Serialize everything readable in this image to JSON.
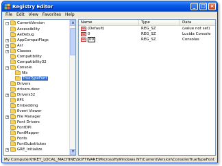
{
  "window": {
    "title": "Registry Editor",
    "icon": "registry-icon"
  },
  "titlebar_buttons": {
    "minimize": "_",
    "maximize": "□",
    "close": "×"
  },
  "menu": [
    {
      "label": "File"
    },
    {
      "label": "Edit"
    },
    {
      "label": "View"
    },
    {
      "label": "Favorites"
    },
    {
      "label": "Help"
    }
  ],
  "tree": {
    "root": "CurrentVersion",
    "items": [
      {
        "label": "Accessibility"
      },
      {
        "label": "AeDebug"
      },
      {
        "label": "AppCompatFlags"
      },
      {
        "label": "Asr"
      },
      {
        "label": "Classes"
      },
      {
        "label": "Compatibility"
      },
      {
        "label": "Compatibility32"
      },
      {
        "label": "Console"
      },
      {
        "label": "Nls"
      },
      {
        "label": "TrueTypeFont"
      },
      {
        "label": "Drivers"
      },
      {
        "label": "drivers.desc"
      },
      {
        "label": "Drivers32"
      },
      {
        "label": "EFS"
      },
      {
        "label": "Embedding"
      },
      {
        "label": "Event Viewer"
      },
      {
        "label": "File Manager"
      },
      {
        "label": "Font Drivers"
      },
      {
        "label": "FontDPI"
      },
      {
        "label": "FontMapper"
      },
      {
        "label": "Fonts"
      },
      {
        "label": "FontSubstitutes"
      },
      {
        "label": "GRE_Initialize"
      }
    ]
  },
  "list": {
    "headers": {
      "name": "Name",
      "type": "Type",
      "data": "Data"
    },
    "rows": [
      {
        "name": "(Default)",
        "type": "REG_SZ",
        "data": "(value not set)"
      },
      {
        "name": "0",
        "type": "REG_SZ",
        "data": "Lucida Console"
      },
      {
        "name": "00",
        "type": "REG_SZ",
        "data": "Consolas"
      }
    ]
  },
  "status": "My Computer\\HKEY_LOCAL_MACHINE\\SOFTWARE\\Microsoft\\Windows NT\\CurrentVersion\\Console\\TrueTypeFont"
}
